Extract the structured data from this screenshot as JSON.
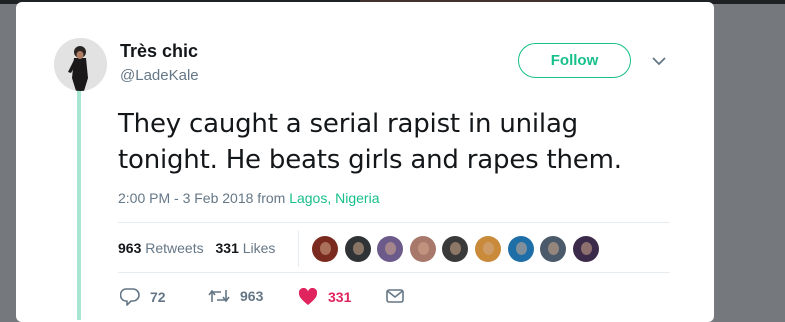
{
  "tweet": {
    "author_name": "Très chic",
    "author_handle": "@LadeKale",
    "follow_label": "Follow",
    "text": "They caught a serial rapist in unilag tonight. He beats girls and rapes them.",
    "timestamp": "2:00 PM - 3 Feb 2018 from",
    "location": "Lagos, Nigeria"
  },
  "stats": {
    "retweets_count": "963",
    "retweets_label": "Retweets",
    "likes_count": "331",
    "likes_label": "Likes"
  },
  "likers": [
    {
      "name": "liker-avatar-1",
      "color": "#7a2a1e"
    },
    {
      "name": "liker-avatar-2",
      "color": "#2f3336"
    },
    {
      "name": "liker-avatar-3",
      "color": "#6b5a8a"
    },
    {
      "name": "liker-avatar-4",
      "color": "#a8786b"
    },
    {
      "name": "liker-avatar-5",
      "color": "#3a3a3a"
    },
    {
      "name": "liker-avatar-6",
      "color": "#c98a3a"
    },
    {
      "name": "liker-avatar-7",
      "color": "#1e6fa8"
    },
    {
      "name": "liker-avatar-8",
      "color": "#4a5a6a"
    },
    {
      "name": "liker-avatar-9",
      "color": "#3b2a4a"
    }
  ],
  "actions": {
    "reply_count": "72",
    "retweet_count": "963",
    "like_count": "331"
  },
  "colors": {
    "accent": "#17bf8b",
    "like": "#e0245e",
    "thread_line": "#a6e5d1",
    "text_secondary": "#657786"
  },
  "icons": [
    "chevron-down-icon",
    "reply-icon",
    "retweet-icon",
    "heart-icon",
    "message-icon"
  ]
}
